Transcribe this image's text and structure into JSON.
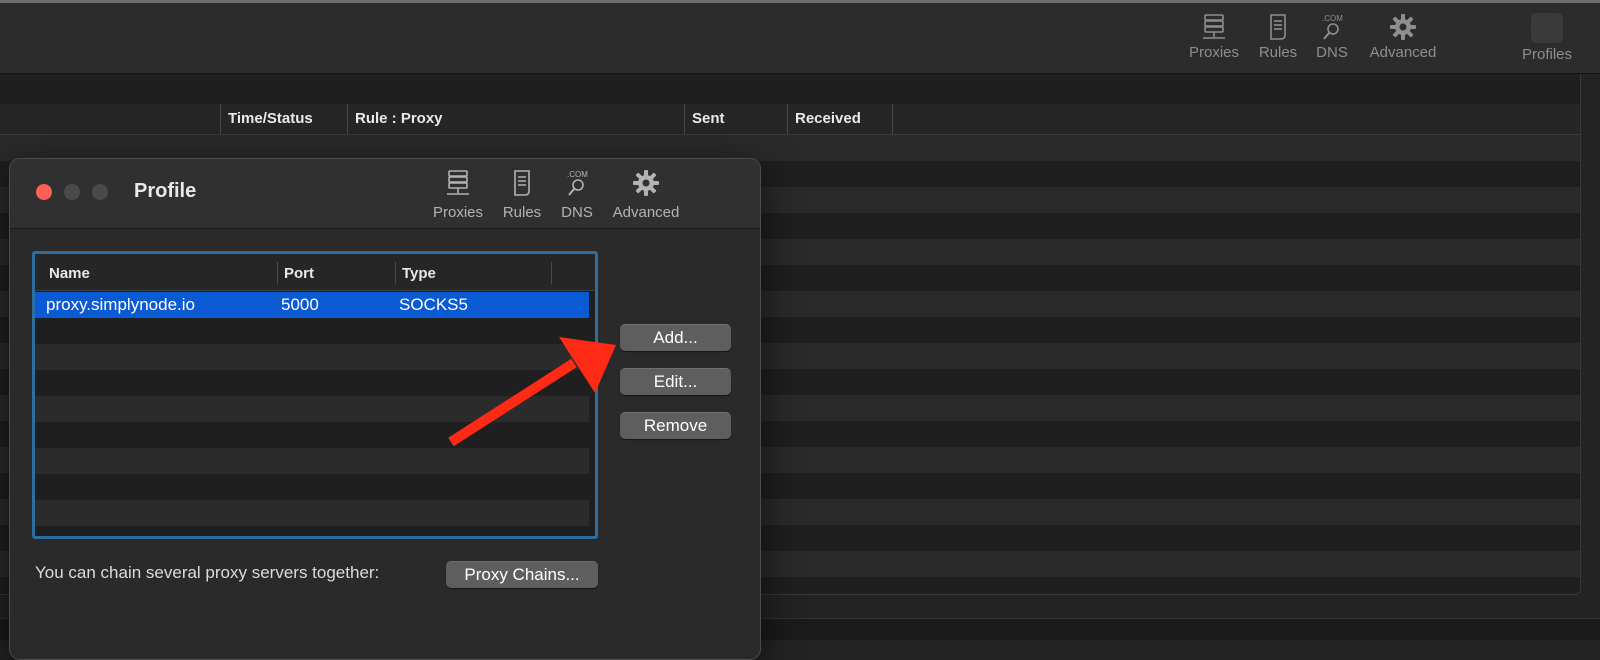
{
  "main_window": {
    "toolbar": [
      {
        "id": "proxies",
        "label": "Proxies",
        "icon": "server-icon"
      },
      {
        "id": "rules",
        "label": "Rules",
        "icon": "document-icon"
      },
      {
        "id": "dns",
        "label": "DNS",
        "icon": "dns-search-icon"
      },
      {
        "id": "advanced",
        "label": "Advanced",
        "icon": "gear-icon"
      },
      {
        "id": "profiles",
        "label": "Profiles",
        "icon": "profiles-icon"
      }
    ],
    "dns_icon_text": ".COM",
    "columns": [
      "Time/Status",
      "Rule : Proxy",
      "Sent",
      "Received"
    ]
  },
  "dialog": {
    "title": "Profile",
    "toolbar": [
      {
        "id": "proxies",
        "label": "Proxies",
        "icon": "server-icon"
      },
      {
        "id": "rules",
        "label": "Rules",
        "icon": "document-icon"
      },
      {
        "id": "dns",
        "label": "DNS",
        "icon": "dns-search-icon"
      },
      {
        "id": "advanced",
        "label": "Advanced",
        "icon": "gear-icon"
      }
    ],
    "dns_icon_text": ".COM",
    "table": {
      "columns": [
        "Name",
        "Port",
        "Type"
      ],
      "rows": [
        {
          "name": "proxy.simplynode.io",
          "port": "5000",
          "type": "SOCKS5",
          "selected": true
        }
      ]
    },
    "buttons": {
      "add": "Add...",
      "edit": "Edit...",
      "remove": "Remove",
      "proxy_chains": "Proxy Chains..."
    },
    "chain_text": "You can chain several proxy servers together:",
    "colors": {
      "selection": "#0a5bd3",
      "table_border": "#2c6ea0",
      "close_button": "#fe5f57",
      "annotation_arrow": "#ff2a16"
    }
  }
}
